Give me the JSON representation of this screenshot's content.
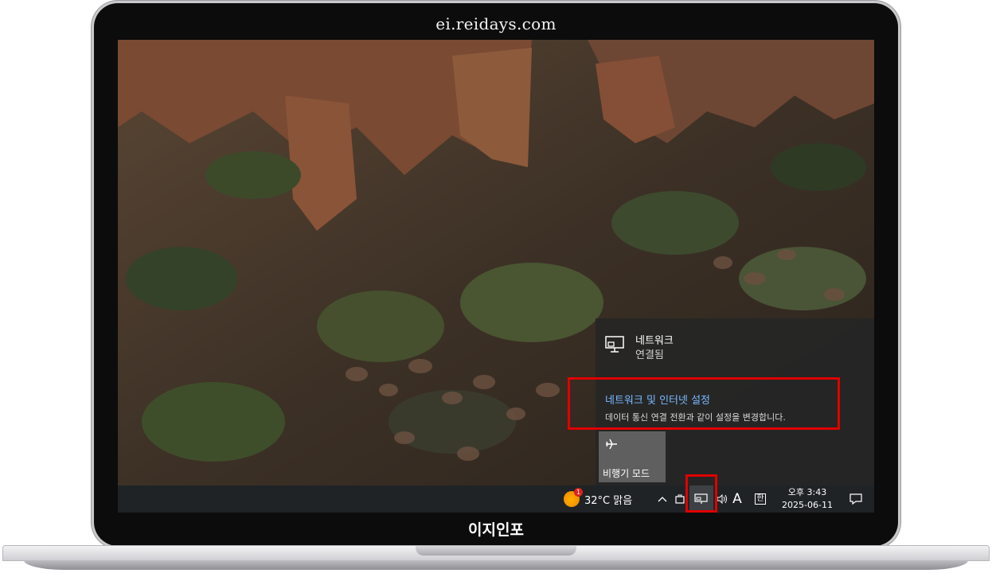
{
  "watermark": "ei.reidays.com",
  "brand": "이지인포",
  "flyout": {
    "network_title": "네트워크",
    "network_status": "연결됨",
    "settings_link": "네트워크 및 인터넷 설정",
    "settings_desc": "데이터 통신 연결 전환과 같이 설정을 변경합니다.",
    "airplane_label": "비행기 모드",
    "icons": {
      "network": "ethernet-monitor-icon",
      "airplane": "airplane-icon"
    }
  },
  "taskbar": {
    "weather_badge": "1",
    "weather": "32°C  맑음",
    "chevron": "^",
    "ime_letter": "A",
    "ime_mode": "한",
    "time": "오후 3:43",
    "date": "2025-06-11",
    "icons": {
      "weather": "sun-icon",
      "chevron": "chevron-up-icon",
      "bag": "briefcase-icon",
      "network": "ethernet-monitor-icon",
      "volume": "speaker-icon",
      "notification": "chat-bubble-icon"
    }
  },
  "colors": {
    "highlight": "#e00000",
    "link": "#79b8ff",
    "flyout_bg": "#262626",
    "taskbar_bg": "#1f2326"
  }
}
